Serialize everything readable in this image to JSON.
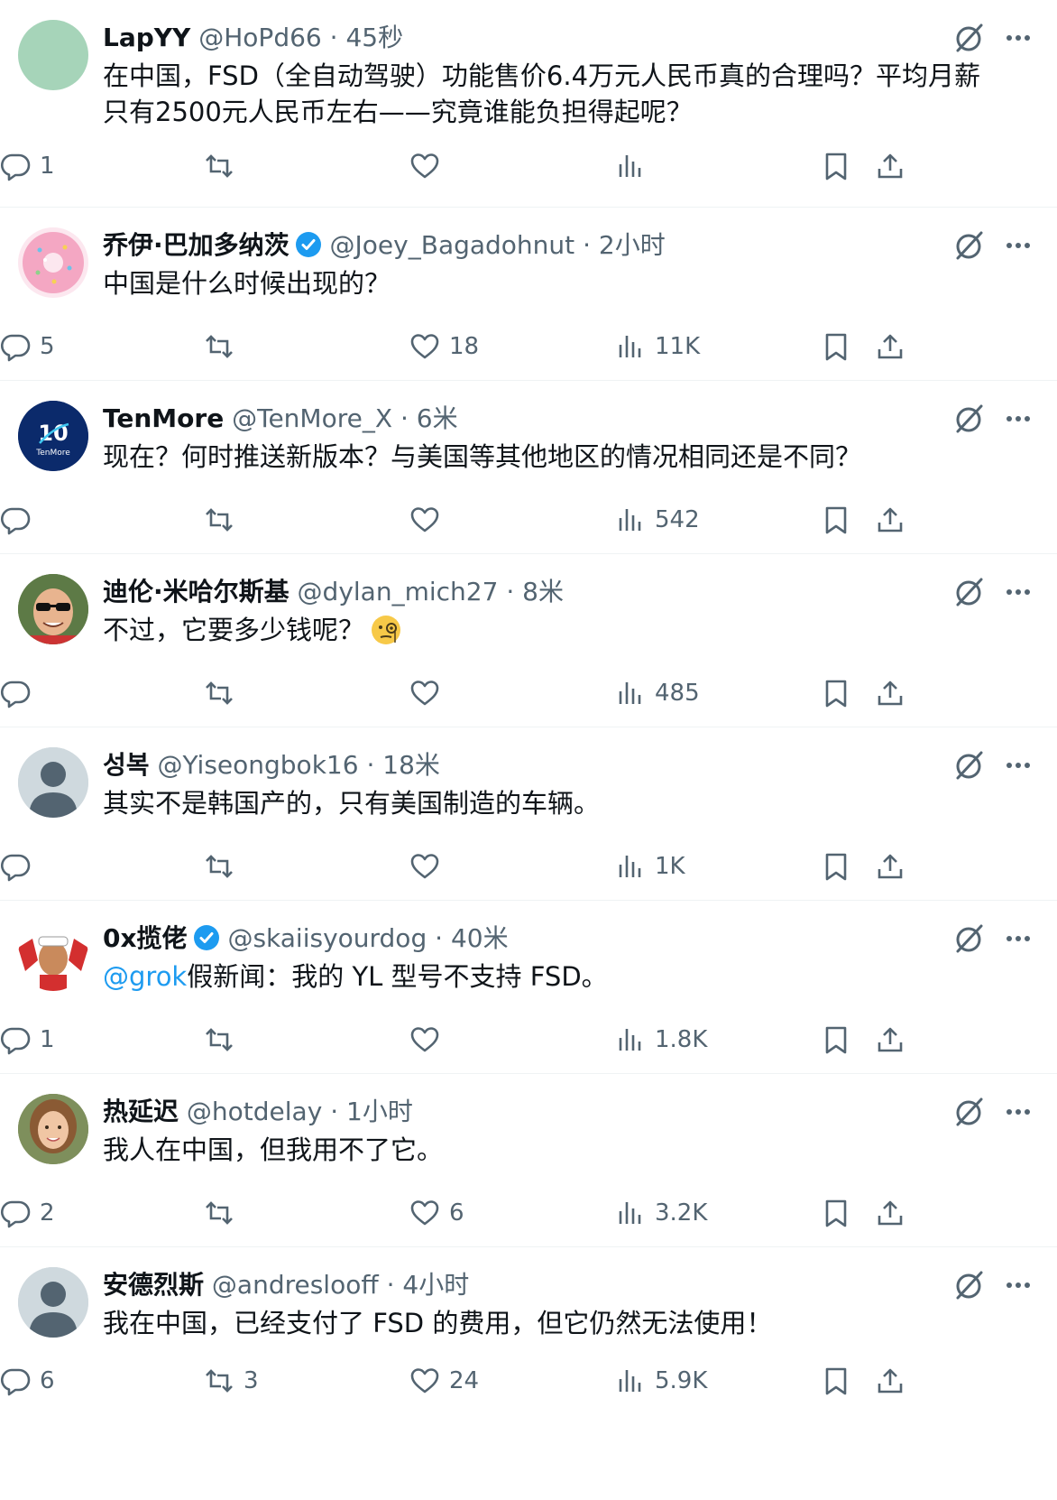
{
  "colors": {
    "accent": "#1d9bf0",
    "text_primary": "#0f1419",
    "text_secondary": "#536471",
    "divider": "#eff3f4"
  },
  "icons": [
    "grok-icon",
    "more-icon",
    "reply-icon",
    "retweet-icon",
    "like-icon",
    "views-icon",
    "bookmark-icon",
    "share-icon",
    "verified-badge-icon"
  ],
  "tweets": [
    {
      "name": "LapYY",
      "handle": "@HoPd66",
      "separator": "·",
      "time": "45秒",
      "text": "在中国，FSD（全自动驾驶）功能售价6.4万元人民币真的合理吗？平均月薪只有2500元人民币左右——究竟谁能负担得起呢？",
      "replies": "1",
      "retweets": "",
      "likes": "",
      "views": ""
    },
    {
      "name": "乔伊·巴加多纳茨",
      "handle": "@Joey_Bagadohnut",
      "separator": "·",
      "time": "2小时",
      "text": "中国是什么时候出现的？",
      "replies": "5",
      "retweets": "",
      "likes": "18",
      "views": "11K"
    },
    {
      "name": "TenMore",
      "handle": "@TenMore_X",
      "separator": "·",
      "time": "6米",
      "text": "现在？何时推送新版本？与美国等其他地区的情况相同还是不同？",
      "replies": "",
      "retweets": "",
      "likes": "",
      "views": "542",
      "avatar_text": "TenMore",
      "avatar_mark": "10"
    },
    {
      "name": "迪伦·米哈尔斯基",
      "handle": "@dylan_mich27",
      "separator": "·",
      "time": "8米",
      "text": "不过，它要多少钱呢？",
      "replies": "",
      "retweets": "",
      "likes": "",
      "views": "485"
    },
    {
      "name": "성복",
      "handle": "@Yiseongbok16",
      "separator": "·",
      "time": "18米",
      "text": "其实不是韩国产的，只有美国制造的车辆。",
      "replies": "",
      "retweets": "",
      "likes": "",
      "views": "1K"
    },
    {
      "name": "0x揽佬",
      "handle": "@skaiisyourdog",
      "separator": "·",
      "time": "40米",
      "mention": "@grok",
      "text": "假新闻：我的 YL 型号不支持 FSD。",
      "replies": "1",
      "retweets": "",
      "likes": "",
      "views": "1.8K"
    },
    {
      "name": "热延迟",
      "handle": "@hotdelay",
      "separator": "·",
      "time": "1小时",
      "text": "我人在中国，但我用不了它。",
      "replies": "2",
      "retweets": "",
      "likes": "6",
      "views": "3.2K"
    },
    {
      "name": "安德烈斯",
      "handle": "@andreslooff",
      "separator": "·",
      "time": "4小时",
      "text": "我在中国，已经支付了 FSD 的费用，但它仍然无法使用！",
      "replies": "6",
      "retweets": "3",
      "likes": "24",
      "views": "5.9K"
    }
  ]
}
